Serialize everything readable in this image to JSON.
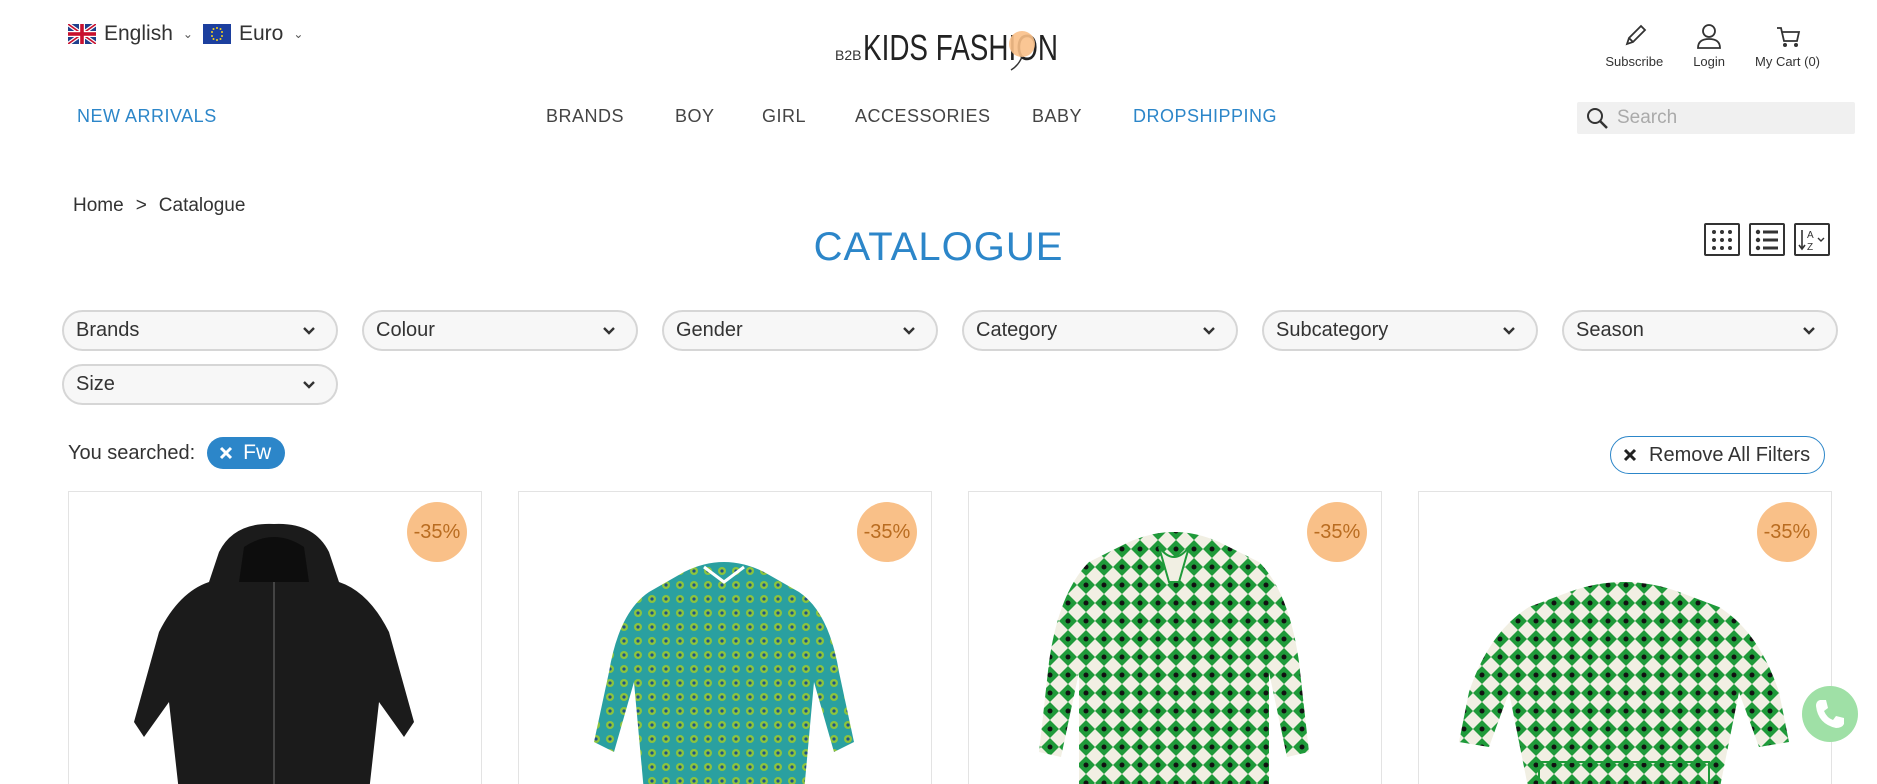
{
  "header": {
    "language": "English",
    "currency": "Euro",
    "logo_prefix": "B2B",
    "logo_text": "KIDS FASHION",
    "account": [
      {
        "label": "Subscribe",
        "icon": "pencil-icon"
      },
      {
        "label": "Login",
        "icon": "user-icon"
      },
      {
        "label": "My Cart (0)",
        "icon": "cart-icon"
      }
    ]
  },
  "nav": {
    "new_arrivals": "NEW ARRIVALS",
    "brands": "BRANDS",
    "boy": "BOY",
    "girl": "GIRL",
    "accessories": "ACCESSORIES",
    "baby": "BABY",
    "dropshipping": "DROPSHIPPING",
    "search_placeholder": "Search"
  },
  "breadcrumb": {
    "home": "Home",
    "separator": ">",
    "current": "Catalogue"
  },
  "page_title": "CATALOGUE",
  "filters": [
    "Brands",
    "Colour",
    "Gender",
    "Category",
    "Subcategory",
    "Season",
    "Size"
  ],
  "search": {
    "label": "You searched:",
    "term": "Fw",
    "remove_all": "Remove All Filters"
  },
  "products": [
    {
      "discount": "-35%",
      "image": "black hooded zip jacket"
    },
    {
      "discount": "-35%",
      "image": "blue green patterned dress"
    },
    {
      "discount": "-35%",
      "image": "green checkered dress with bow"
    },
    {
      "discount": "-35%",
      "image": "green checkered blouse"
    }
  ],
  "colors": {
    "accent": "#2c86c9",
    "badge_bg": "#f9c088",
    "badge_text": "#b96c20"
  }
}
